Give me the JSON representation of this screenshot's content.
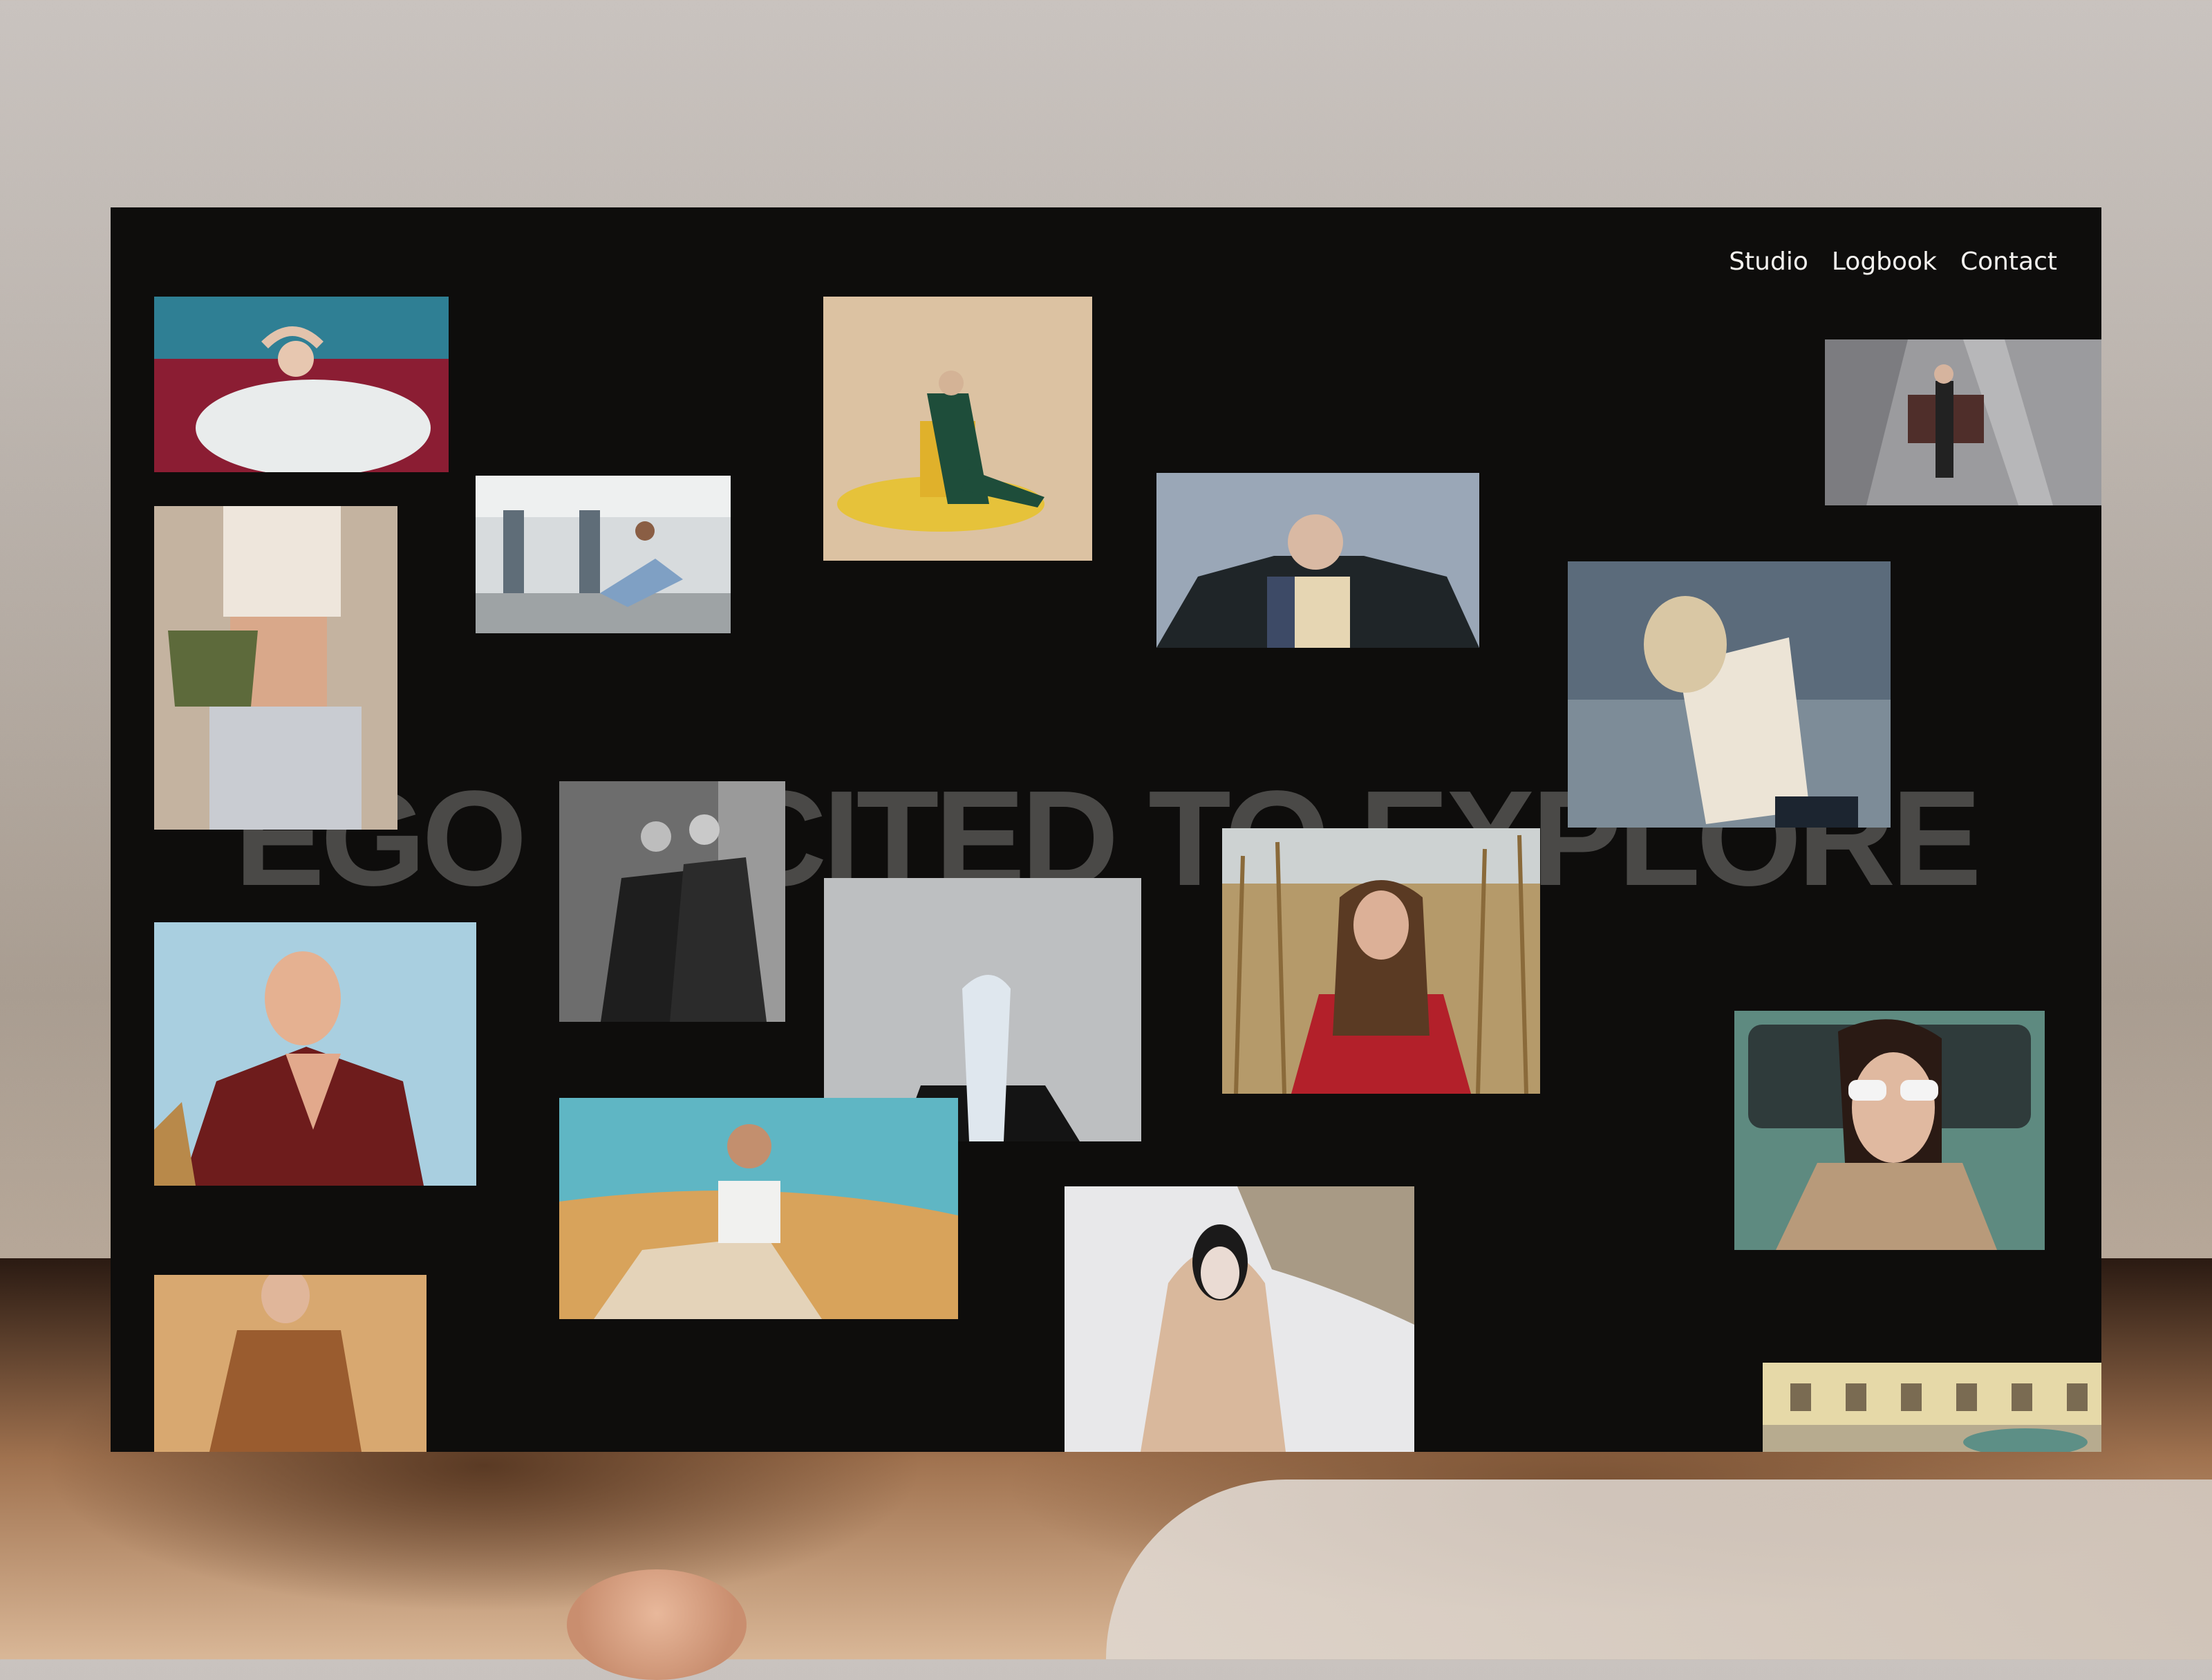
{
  "nav": {
    "items": [
      {
        "label": "Studio"
      },
      {
        "label": "Logbook"
      },
      {
        "label": "Contact"
      }
    ]
  },
  "hero": {
    "headline": "EGO EXCITED TO EXPLORE"
  },
  "colors": {
    "panel": "#0e0d0c",
    "nav_text": "#f4f2ef",
    "headline": "#4a4947"
  },
  "gallery": {
    "photos": [
      {
        "subject": "woman in tulle dress on red velvet sofa"
      },
      {
        "subject": "woman with crop top and green bag"
      },
      {
        "subject": "woman in denim sitting on motel porch"
      },
      {
        "subject": "person in green suit on yellow chair"
      },
      {
        "subject": "woman in dark coat against sky"
      },
      {
        "subject": "woman sitting on chair from above"
      },
      {
        "subject": "blonde woman in white shirt against sky"
      },
      {
        "subject": "woman in red patterned wrap"
      },
      {
        "subject": "black and white two women by wall"
      },
      {
        "subject": "figure with white veil over face"
      },
      {
        "subject": "woman in red jacket in cornfield"
      },
      {
        "subject": "woman with cat-eye sunglasses in car"
      },
      {
        "subject": "woman in sunglasses in desert"
      },
      {
        "subject": "woman in knit coat in snow"
      },
      {
        "subject": "woman in brown jacket"
      },
      {
        "subject": "vintage building facade with car"
      }
    ]
  }
}
